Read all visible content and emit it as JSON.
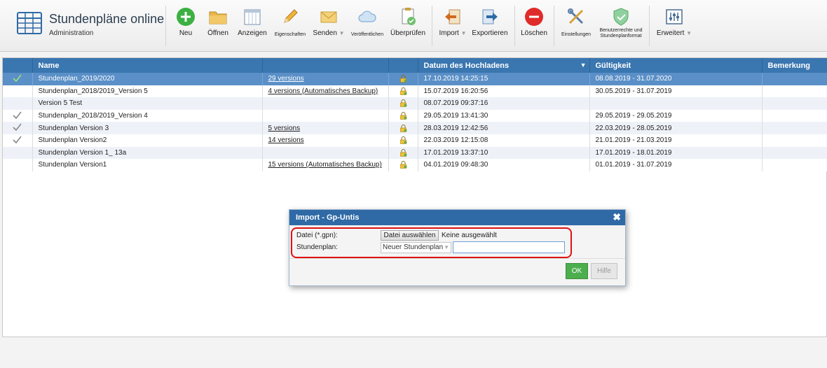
{
  "app": {
    "title": "Stundenpläne online",
    "subtitle": "Administration"
  },
  "toolbar": {
    "buttons": [
      {
        "label": "Neu",
        "icon": "plus-circle-icon"
      },
      {
        "label": "Öffnen",
        "icon": "folder-icon"
      },
      {
        "label": "Anzeigen",
        "icon": "calendar-grid-icon"
      },
      {
        "label": "Eigenschaften",
        "icon": "pencil-icon"
      },
      {
        "label": "Senden",
        "icon": "envelope-icon"
      },
      {
        "label": "Veröffentlichen",
        "icon": "cloud-icon"
      },
      {
        "label": "Überprüfen",
        "icon": "check-document-icon"
      },
      {
        "label": "Import",
        "icon": "import-arrow-icon"
      },
      {
        "label": "Exportieren",
        "icon": "export-arrow-icon"
      },
      {
        "label": "Löschen",
        "icon": "minus-circle-icon"
      },
      {
        "label": "Einstellungen",
        "icon": "tools-icon"
      },
      {
        "label": "Benutzerrechte und Stundenplanformat",
        "icon": "shield-check-icon"
      },
      {
        "label": "Erweitert",
        "icon": "sliders-icon"
      }
    ]
  },
  "table": {
    "columns": [
      "",
      "Name",
      "",
      "",
      "Datum des Hochladens",
      "Gültigkeit",
      "Bemerkung"
    ],
    "rows": [
      {
        "checked": true,
        "name": "Stundenplan_2019/2020",
        "versions": "29 versions",
        "uploaded": "17.10.2019 14:25:15",
        "validity": "08.08.2019 - 31.07.2020",
        "note": ""
      },
      {
        "checked": false,
        "name": "Stundenplan_2018/2019_Version 5",
        "versions": "4 versions (Automatisches Backup)",
        "uploaded": "15.07.2019 16:20:56",
        "validity": "30.05.2019 - 31.07.2019",
        "note": ""
      },
      {
        "checked": false,
        "name": "Version 5 Test",
        "versions": "",
        "uploaded": "08.07.2019 09:37:16",
        "validity": "",
        "note": ""
      },
      {
        "checked": true,
        "name": "Stundenplan_2018/2019_Version 4",
        "versions": "",
        "uploaded": "29.05.2019 13:41:30",
        "validity": "29.05.2019 - 29.05.2019",
        "note": ""
      },
      {
        "checked": true,
        "name": "Stundenplan Version 3",
        "versions": "5 versions",
        "uploaded": "28.03.2019 12:42:56",
        "validity": "22.03.2019 - 28.05.2019",
        "note": ""
      },
      {
        "checked": true,
        "name": "Stundenplan Version2",
        "versions": "14 versions",
        "uploaded": "22.03.2019 12:15:08",
        "validity": "21.01.2019 - 21.03.2019",
        "note": ""
      },
      {
        "checked": false,
        "name": "Stundenplan Version 1_ 13a",
        "versions": "",
        "uploaded": "17.01.2019 13:37:10",
        "validity": "17.01.2019 - 18.01.2019",
        "note": ""
      },
      {
        "checked": false,
        "name": "Stundenplan Version1",
        "versions": "15 versions (Automatisches Backup)",
        "uploaded": "04.01.2019 09:48:30",
        "validity": "01.01.2019 - 31.07.2019",
        "note": ""
      }
    ]
  },
  "dialog": {
    "title": "Import - Gp-Untis",
    "file_label": "Datei (*.gpn):",
    "file_button": "Datei auswählen",
    "file_status": "Keine ausgewählt",
    "plan_label": "Stundenplan:",
    "plan_select": "Neuer Stundenplan",
    "plan_name_value": "",
    "ok_label": "OK",
    "help_label": "Hilfe"
  },
  "colors": {
    "header_blue": "#3a76b0",
    "selected_row": "#5a8fc7",
    "ok_green": "#4cae4c",
    "highlight_red": "#e01010"
  }
}
